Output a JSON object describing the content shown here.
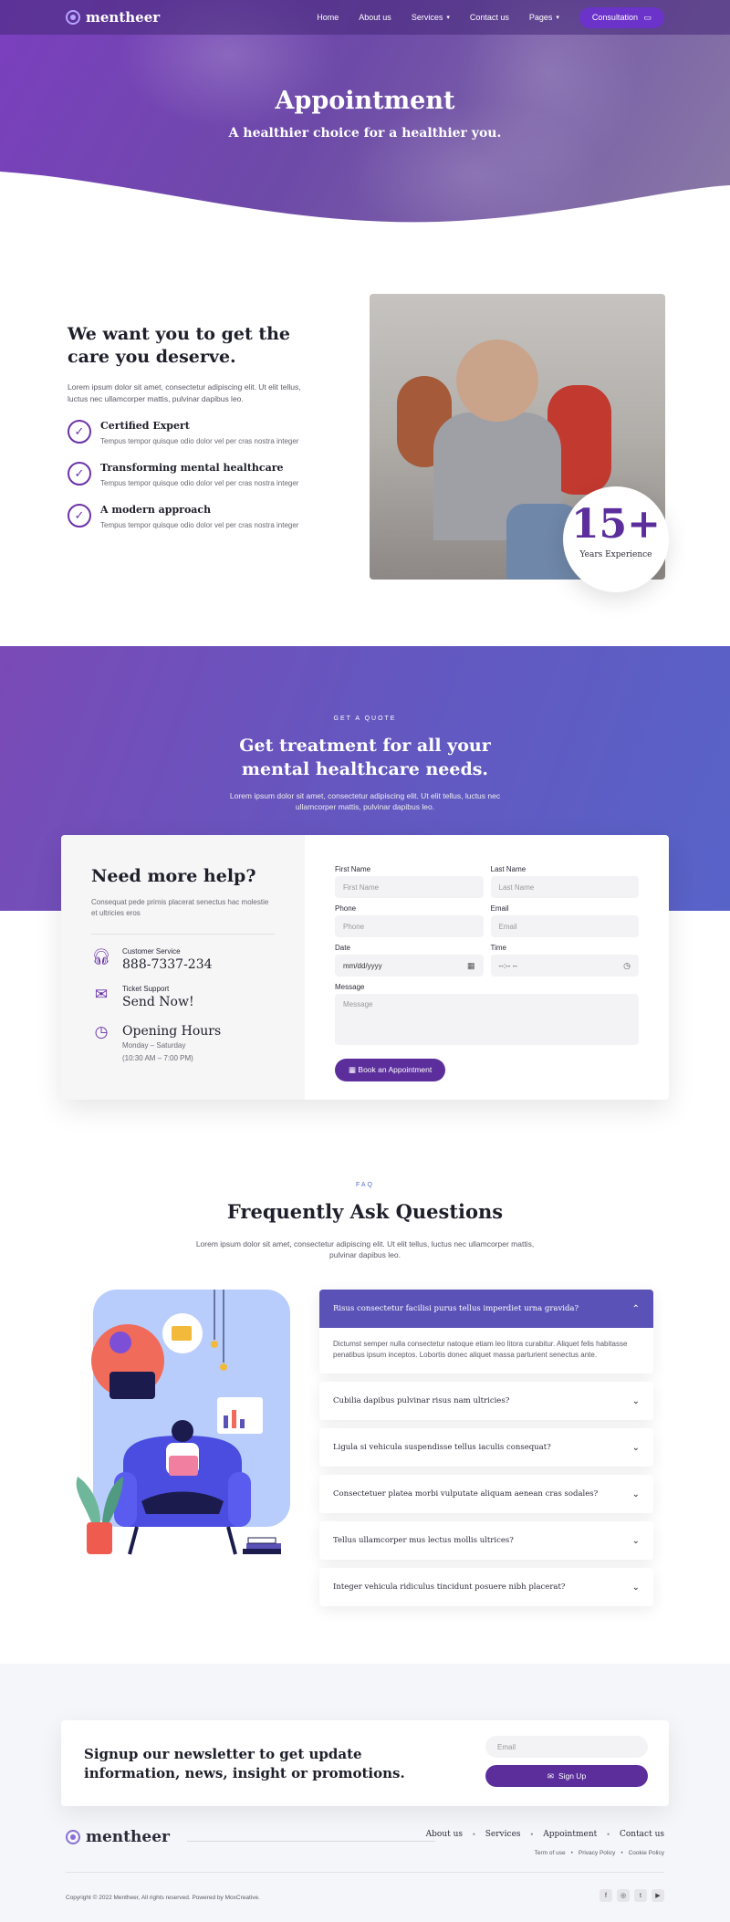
{
  "header": {
    "brand": "mentheer",
    "nav": [
      "Home",
      "About us",
      "Services",
      "Contact us",
      "Pages"
    ],
    "cta": "Consultation"
  },
  "hero": {
    "title": "Appointment",
    "subtitle": "A healthier choice for a healthier you."
  },
  "care": {
    "title": "We want you to get the care you deserve.",
    "description": "Lorem ipsum dolor sit amet, consectetur adipiscing elit. Ut elit tellus, luctus nec ullamcorper mattis, pulvinar dapibus leo.",
    "features": [
      {
        "title": "Certified Expert",
        "text": "Tempus tempor quisque odio dolor vel per cras nostra integer"
      },
      {
        "title": "Transforming mental healthcare",
        "text": "Tempus tempor quisque odio dolor vel per cras nostra integer"
      },
      {
        "title": "A modern approach",
        "text": "Tempus tempor quisque odio dolor vel per cras nostra integer"
      }
    ],
    "experience_number": "15+",
    "experience_label": "Years Experience"
  },
  "quote": {
    "kicker": "GET A QUOTE",
    "title": "Get treatment for all your mental healthcare needs.",
    "description": "Lorem ipsum dolor sit amet, consectetur adipiscing elit. Ut elit tellus, luctus nec ullamcorper mattis, pulvinar dapibus leo."
  },
  "help": {
    "title": "Need more help?",
    "description": "Consequat pede primis placerat senectus hac molestie et ultricies eros",
    "customer_service_label": "Customer Service",
    "customer_service_value": "888-7337-234",
    "ticket_label": "Ticket Support",
    "ticket_value": "Send Now!",
    "hours_title": "Opening Hours",
    "hours_days": "Monday – Saturday",
    "hours_time": "(10:30 AM – 7:00 PM)"
  },
  "form": {
    "first_name_label": "First Name",
    "first_name_placeholder": "First Name",
    "last_name_label": "Last Name",
    "last_name_placeholder": "Last Name",
    "phone_label": "Phone",
    "phone_placeholder": "Phone",
    "email_label": "Email",
    "email_placeholder": "Email",
    "date_label": "Date",
    "date_value": "mm/dd/yyyy",
    "time_label": "Time",
    "time_value": "--:-- --",
    "message_label": "Message",
    "message_placeholder": "Message",
    "submit": "Book an Appointment"
  },
  "faq": {
    "kicker": "FAQ",
    "title": "Frequently Ask Questions",
    "description": "Lorem ipsum dolor sit amet, consectetur adipiscing elit. Ut elit tellus, luctus nec ullamcorper mattis, pulvinar dapibus leo.",
    "items": [
      {
        "q": "Risus consectetur facilisi purus tellus imperdiet urna gravida?",
        "a": "Dictumst semper nulla consectetur natoque etiam leo litora curabitur. Aliquet felis habitasse penatibus ipsum inceptos. Lobortis donec aliquet massa parturient senectus ante."
      },
      {
        "q": "Cubilia dapibus pulvinar risus nam ultricies?"
      },
      {
        "q": "Ligula si vehicula suspendisse tellus iaculis consequat?"
      },
      {
        "q": "Consectetuer platea morbi vulputate aliquam aenean cras sodales?"
      },
      {
        "q": "Tellus ullamcorper mus lectus mollis ultrices?"
      },
      {
        "q": "Integer vehicula ridiculus tincidunt posuere nibh placerat?"
      }
    ]
  },
  "newsletter": {
    "text": "Signup our newsletter to get update information, news, insight or promotions.",
    "email_placeholder": "Email",
    "button": "Sign Up"
  },
  "footer": {
    "brand": "mentheer",
    "nav": [
      "About us",
      "Services",
      "Appointment",
      "Contact us"
    ],
    "legal": [
      "Term of use",
      "Privacy Policy",
      "Cookie Policy"
    ],
    "copyright": "Copyright © 2022 Mentheer, All rights reserved. Powered by MoxCreative."
  },
  "colors": {
    "primary": "#5b2e9c",
    "accent": "#5a52b7"
  }
}
